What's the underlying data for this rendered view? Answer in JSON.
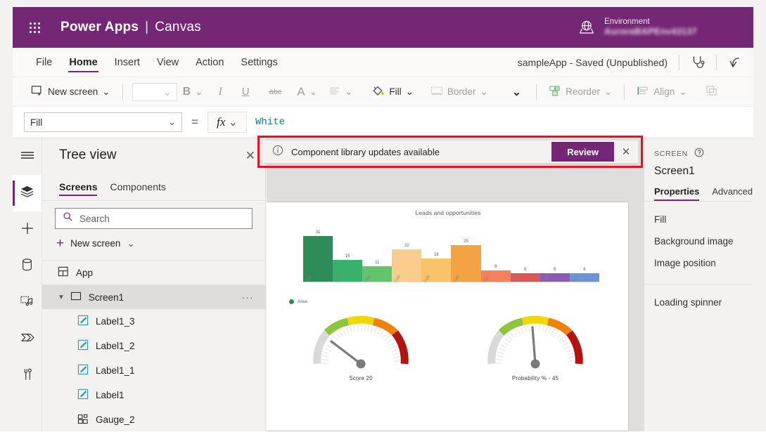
{
  "brand": {
    "waffle_icon": "waffle-grid-icon",
    "product": "Power Apps",
    "separator": "|",
    "mode": "Canvas",
    "environment_label": "Environment",
    "environment_name": "AuroraBAPEnv43137",
    "globe_icon": "environment-globe-icon",
    "bar_color": "#742774"
  },
  "menubar": {
    "items": [
      {
        "label": "File",
        "active": false
      },
      {
        "label": "Home",
        "active": true
      },
      {
        "label": "Insert",
        "active": false
      },
      {
        "label": "View",
        "active": false
      },
      {
        "label": "Action",
        "active": false
      },
      {
        "label": "Settings",
        "active": false
      }
    ],
    "app_status": "sampleApp - Saved (Unpublished)",
    "checker_icon": "app-checker-stethoscope-icon",
    "undo_icon": "undo-arrow-icon"
  },
  "ribbon": {
    "new_screen": "New screen",
    "new_screen_icon": "new-screen-icon",
    "font_size_value": "",
    "bold": "B",
    "italic": "I",
    "underline": "U",
    "strikethrough": "abc",
    "font_color_icon": "font-color-A-icon",
    "align_icon": "text-align-icon",
    "fill": "Fill",
    "fill_icon": "fill-paint-bucket-icon",
    "border": "Border",
    "border_icon": "border-icon",
    "more_icon": "chevron-down-icon",
    "reorder": "Reorder",
    "reorder_icon": "reorder-icon",
    "align": "Align",
    "align_group_icon": "align-group-icon",
    "group_icon": "group-icon"
  },
  "formula_bar": {
    "property": "Fill",
    "equals": "=",
    "fx_label": "fx",
    "value": "White"
  },
  "rail": {
    "items": [
      {
        "icon": "hamburger-menu-icon",
        "selected": false
      },
      {
        "icon": "tree-view-layers-icon",
        "selected": true
      },
      {
        "icon": "insert-plus-icon",
        "selected": false
      },
      {
        "icon": "data-database-icon",
        "selected": false
      },
      {
        "icon": "media-icon",
        "selected": false
      },
      {
        "icon": "power-automate-flow-icon",
        "selected": false
      },
      {
        "icon": "variables-tools-icon",
        "selected": false
      }
    ]
  },
  "tree_view": {
    "title": "Tree view",
    "close_icon": "close-icon",
    "tabs": [
      {
        "label": "Screens",
        "active": true
      },
      {
        "label": "Components",
        "active": false
      }
    ],
    "search_placeholder": "Search",
    "search_icon": "search-icon",
    "search_value": "",
    "new_screen": "New screen",
    "new_screen_plus_icon": "plus-icon",
    "new_screen_chevron": "chevron-down-icon",
    "items": [
      {
        "label": "App",
        "icon": "app-icon",
        "level": 0,
        "selected": false,
        "expandable": false
      },
      {
        "label": "Screen1",
        "icon": "screen-icon",
        "level": 0,
        "selected": true,
        "expandable": true,
        "overflow": "···"
      },
      {
        "label": "Label1_3",
        "icon": "label-icon",
        "level": 1,
        "selected": false
      },
      {
        "label": "Label1_2",
        "icon": "label-icon",
        "level": 1,
        "selected": false
      },
      {
        "label": "Label1_1",
        "icon": "label-icon",
        "level": 1,
        "selected": false
      },
      {
        "label": "Label1",
        "icon": "label-icon",
        "level": 1,
        "selected": false
      },
      {
        "label": "Gauge_2",
        "icon": "gauge-component-icon",
        "level": 1,
        "selected": false
      }
    ]
  },
  "banner": {
    "info_icon": "info-circle-icon",
    "message": "Component library updates available",
    "review_label": "Review",
    "close_icon": "close-icon",
    "highlight_color": "#e81123",
    "button_color": "#742774"
  },
  "properties_panel": {
    "kind": "SCREEN",
    "help_icon": "help-circle-icon",
    "name": "Screen1",
    "tabs": [
      {
        "label": "Properties",
        "active": true
      },
      {
        "label": "Advanced",
        "active": false
      }
    ],
    "properties": [
      "Fill",
      "Background image",
      "Image position"
    ],
    "properties_secondary": [
      "Loading spinner"
    ]
  },
  "chart_data": {
    "type": "bar",
    "title": "Leads and opportunities",
    "xlabel": "",
    "ylabel": "",
    "ylim": [
      0,
      34
    ],
    "grid": false,
    "legend": [
      "Area"
    ],
    "legend_position": "bottom-left",
    "legend_color": "#2e8b57",
    "categories": [
      "Cat1",
      "Cat2",
      "Cat3",
      "Cat4",
      "Cat5",
      "Cat6",
      "Cat7",
      "Cat8",
      "Cat9",
      "Cat10"
    ],
    "values": [
      31,
      15,
      11,
      22,
      16,
      25,
      8,
      6,
      6,
      6
    ],
    "colors": [
      "#2e8b57",
      "#38b16a",
      "#62c46e",
      "#f8cd8e",
      "#f9c268",
      "#f2a444",
      "#f2825c",
      "#d8575b",
      "#8a5bb5",
      "#6d93d6"
    ]
  },
  "gauges": [
    {
      "caption": "Score   20",
      "value": 20,
      "min": 0,
      "max": 100,
      "needle_angle": -58
    },
    {
      "caption": "Probability % -  45",
      "value": 45,
      "min": 0,
      "max": 100,
      "needle_angle": -4
    }
  ]
}
